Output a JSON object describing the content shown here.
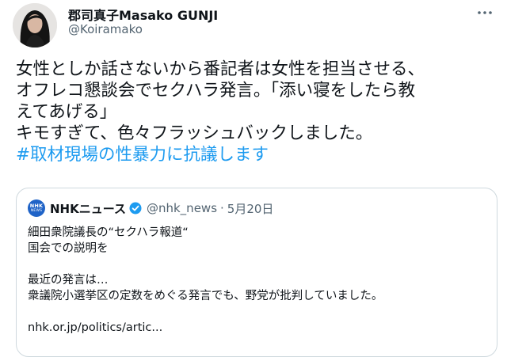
{
  "author": {
    "name": "郡司真子Masako GUNJI",
    "handle": "@Koiramako"
  },
  "tweet": {
    "lines": [
      "女性としか話さないから番記者は女性を担当させる、",
      "オフレコ懇談会でセクハラ発言。「添い寝をしたら教",
      "えてあげる」",
      "キモすぎて、色々フラッシュバックしました。"
    ],
    "hashtag": "#取材現場の性暴力に抗議します"
  },
  "quote": {
    "logo_text": "NHK",
    "logo_subtext": "NEWS",
    "name": "NHKニュース",
    "handle": "@nhk_news",
    "separator": "·",
    "date": "5月20日",
    "lines": [
      "細田衆院議長の“セクハラ報道“",
      "国会での説明を",
      "",
      "最近の発言は…",
      "衆議院小選挙区の定数をめぐる発言でも、野党が批判していました。",
      "",
      "nhk.or.jp/politics/artic..."
    ]
  },
  "colors": {
    "text": "#0f1419",
    "secondary": "#536471",
    "link": "#1d9bf0",
    "border": "#cfd9de",
    "nhk_blue": "#1f63c7"
  },
  "icons": {
    "more": "more-dots-icon",
    "verified": "verified-badge-icon",
    "logo": "nhk-news-logo"
  }
}
